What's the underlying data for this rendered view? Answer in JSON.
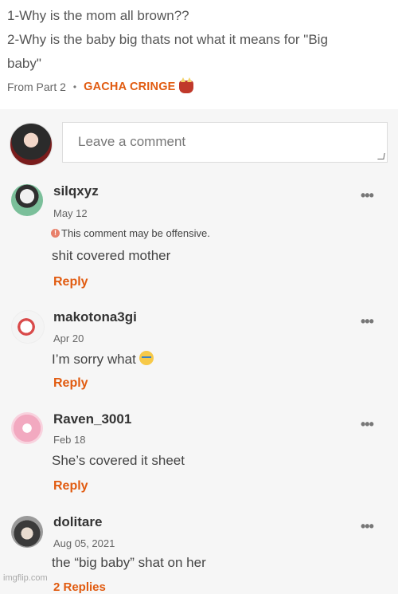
{
  "post": {
    "question_1": "1-Why is the mom all brown??",
    "question_2_line1": "2-Why is the baby big thats not what it means for \"Big",
    "question_2_line2": "baby\"",
    "from_label": "From Part 2",
    "separator": "•",
    "tag": "GACHA CRINGE",
    "tag_icon": "oni-mask-emoji"
  },
  "composer": {
    "placeholder": "Leave a comment"
  },
  "comments": [
    {
      "user": "silqxyz",
      "date": "May 12",
      "warning": "This comment may be offensive.",
      "text": "shit covered mother",
      "reply": "Reply",
      "more": "•••"
    },
    {
      "user": "makotona3gi",
      "date": "Apr 20",
      "text": "I’m sorry what",
      "text_emoji": "crying-face-emoji",
      "reply": "Reply",
      "more": "•••"
    },
    {
      "user": "Raven_3001",
      "date": "Feb 18",
      "text": "She’s covered it sheet",
      "reply": "Reply",
      "more": "•••"
    },
    {
      "user": "dolitare",
      "date": "Aug 05, 2021",
      "text": "the “big baby” shat on her",
      "replies": "2 Replies",
      "more": "•••"
    }
  ],
  "watermark": "imgflip.com",
  "colors": {
    "accent": "#e15b10",
    "background": "#f6f6f6"
  }
}
